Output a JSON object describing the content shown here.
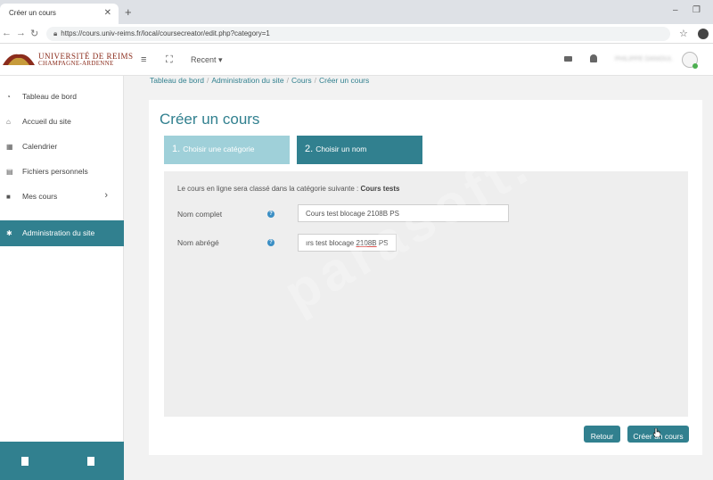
{
  "browser": {
    "tab_title": "Créer un cours",
    "tab_close": "✕",
    "new_tab": "+",
    "url": "https://cours.univ-reims.fr/local/coursecreator/edit.php?category=1"
  },
  "logo": {
    "line1": "UNIVERSITÉ DE REIMS",
    "line2": "CHAMPAGNE-ARDENNE",
    "colors": {
      "brand": "#8b2c1c"
    }
  },
  "navbar": {
    "recent_label": "Recent ▾",
    "user_name": "PHILIPPE DANIOUL"
  },
  "sidebar": {
    "items": [
      {
        "label": "Tableau de bord",
        "icon": "dashboard-icon"
      },
      {
        "label": "Accueil du site",
        "icon": "home-icon"
      },
      {
        "label": "Calendrier",
        "icon": "calendar-icon"
      },
      {
        "label": "Fichiers personnels",
        "icon": "files-icon"
      },
      {
        "label": "Mes cours",
        "icon": "courses-icon"
      },
      {
        "label": "Administration du site",
        "icon": "gear-icon",
        "active": true
      }
    ]
  },
  "breadcrumb": [
    "Tableau de bord",
    "Administration du site",
    "Cours",
    "Créer un cours"
  ],
  "page": {
    "title": "Créer un cours",
    "steps": [
      {
        "num": "1.",
        "label": "Choisir une catégorie"
      },
      {
        "num": "2.",
        "label": "Choisir un nom"
      }
    ],
    "info_prefix": "Le cours en ligne sera classé dans la catégorie suivante : ",
    "info_category": "Cours tests",
    "fields": {
      "fullname_label": "Nom complet",
      "fullname_value": "Cours test blocage 2108B PS",
      "shortname_label": "Nom abrégé",
      "shortname_value_a": "ırs test blocage ",
      "shortname_value_b": "2108B",
      "shortname_value_c": " PS"
    },
    "buttons": {
      "back": "Retour",
      "create": "Créer un cours"
    }
  },
  "colors": {
    "accent": "#31808f",
    "accent_light": "#9fd0d9",
    "help": "#3a8ec4"
  },
  "watermark": "parasoft.co"
}
